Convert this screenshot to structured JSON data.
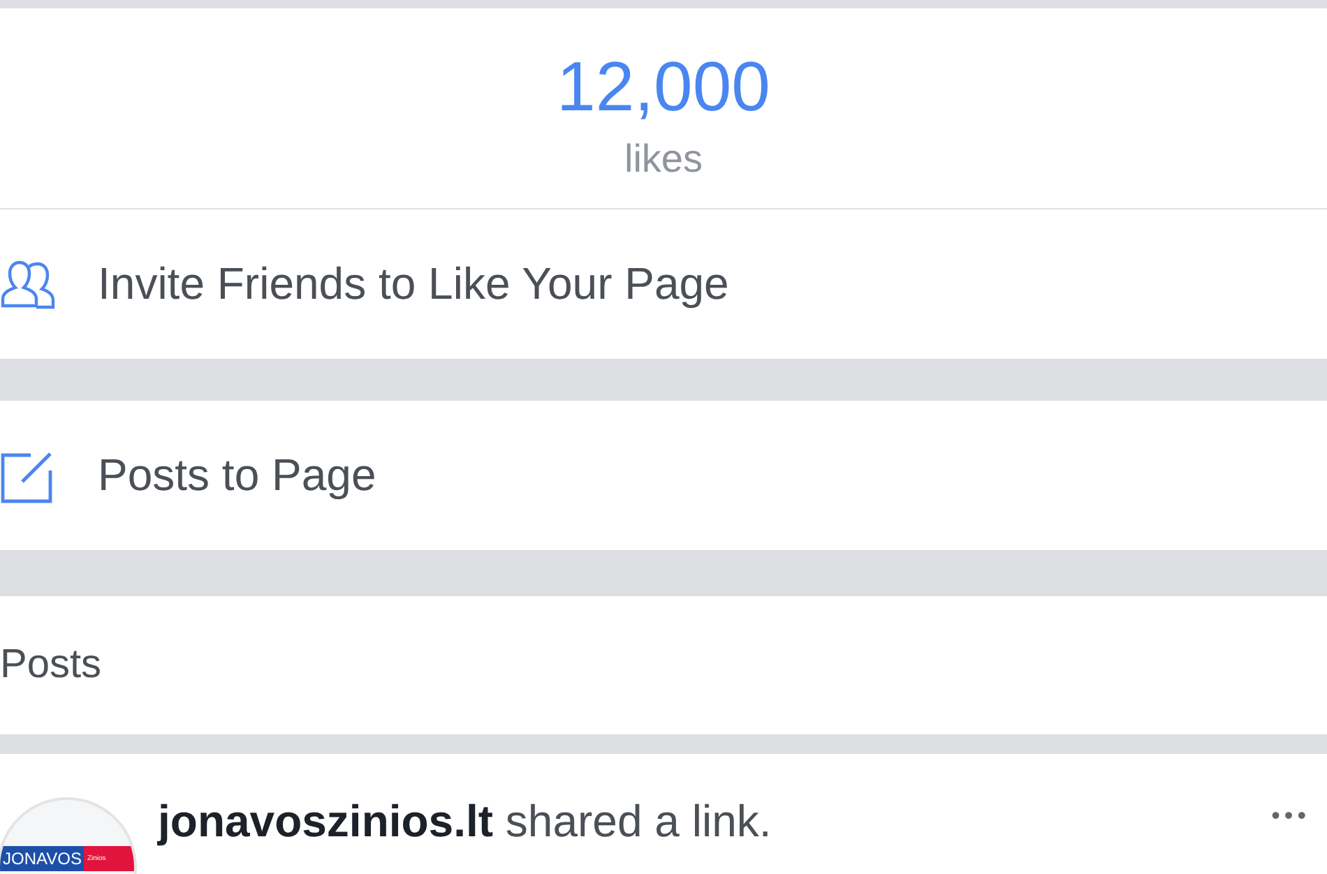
{
  "likes": {
    "count": "12,000",
    "label": "likes"
  },
  "actions": [
    {
      "kind": "invite",
      "label": "Invite Friends to Like Your Page"
    },
    {
      "kind": "posts",
      "label": "Posts to Page"
    }
  ],
  "posts_header": "Posts",
  "post": {
    "avatar_logo": {
      "title": "JONAVOS",
      "subtitle": "Zinios"
    },
    "author": "jonavoszinios.lt",
    "action": "shared a link.",
    "more": "•••"
  }
}
